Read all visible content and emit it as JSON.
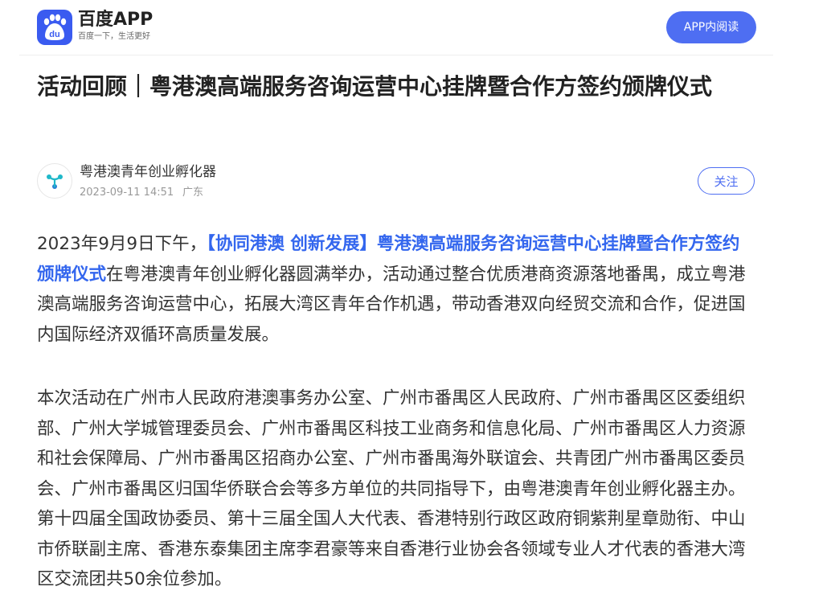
{
  "header": {
    "app_name": "百度APP",
    "slogan": "百度一下，生活更好",
    "open_in_app_label": "APP内阅读",
    "brand_color": "#3a5bf0"
  },
  "article": {
    "title": "活动回顾｜粤港澳高端服务咨询运营中心挂牌暨合作方签约颁牌仪式",
    "author": {
      "name": "粤港澳青年创业孵化器",
      "date": "2023-09-11 14:51",
      "location": "广东",
      "follow_label": "关注"
    },
    "paragraph1": {
      "prefix": "2023年9月9日下午，",
      "highlight": "【协同港澳 创新发展】粤港澳高端服务咨询运营中心挂牌暨合作方签约颁牌仪式",
      "suffix": "在粤港澳青年创业孵化器圆满举办，活动通过整合优质港商资源落地番禺，成立粤港澳高端服务咨询运营中心，拓展大湾区青年合作机遇，带动香港双向经贸交流和合作，促进国内国际经济双循环高质量发展。"
    },
    "paragraph2": "本次活动在广州市人民政府港澳事务办公室、广州市番禺区人民政府、广州市番禺区区委组织部、广州大学城管理委员会、广州市番禺区科技工业商务和信息化局、广州市番禺区人力资源和社会保障局、广州市番禺区招商办公室、广州市番禺海外联谊会、共青团广州市番禺区委员会、广州市番禺区归国华侨联合会等多方单位的共同指导下，由粤港澳青年创业孵化器主办。第十四届全国政协委员、第十三届全国人大代表、香港特别行政区政府铜紫荆星章勋衔、中山市侨联副主席、香港东泰集团主席李君豪等来自香港行业协会各领域专业人才代表的香港大湾区交流团共50余位参加。",
    "highlight_color": "#3366ee"
  },
  "icons": {
    "logo": "baidu-paw-icon",
    "avatar": "incubator-logo-icon"
  }
}
